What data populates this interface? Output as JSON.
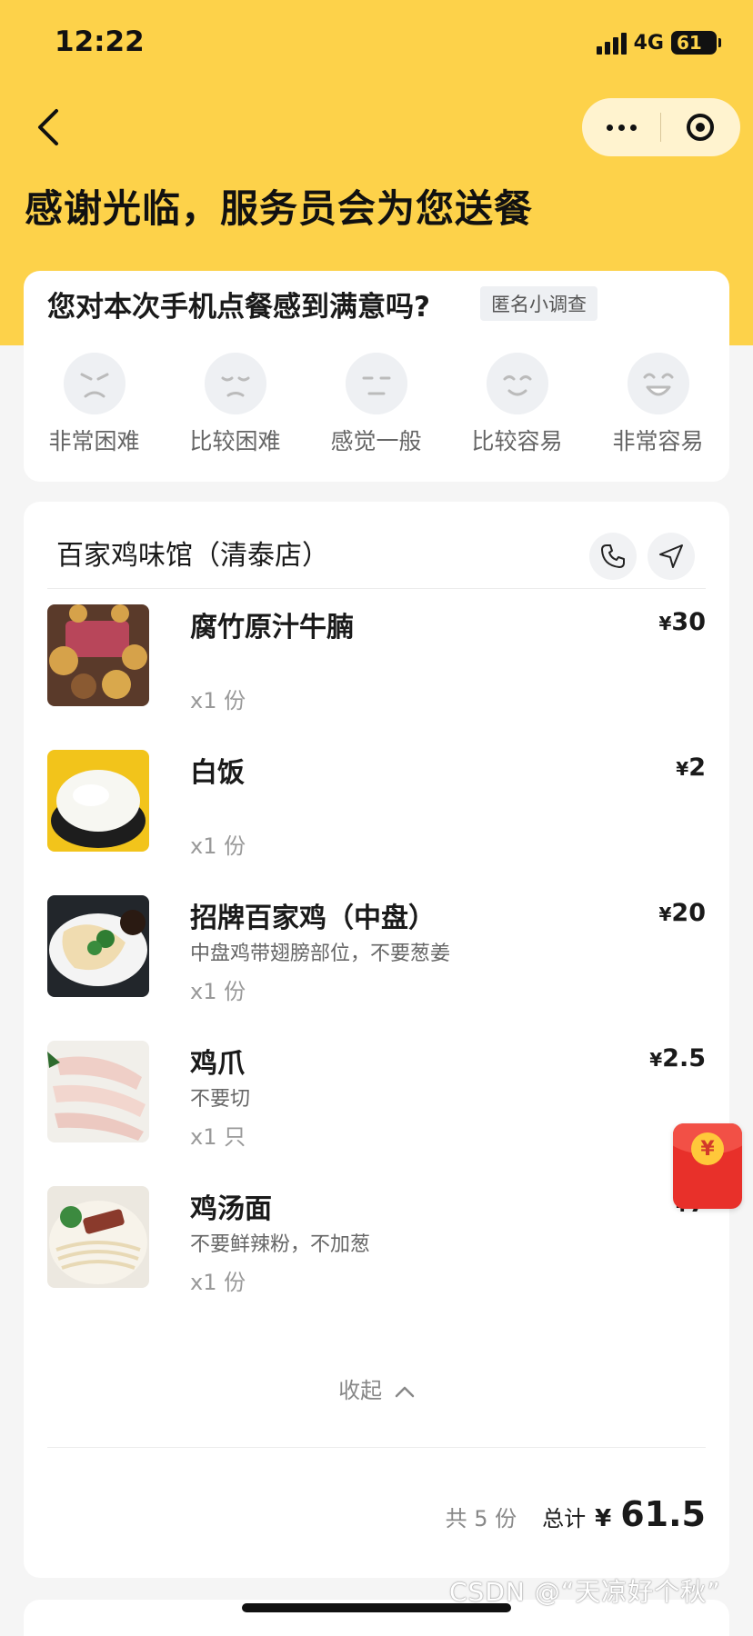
{
  "status_bar": {
    "time": "12:22",
    "network": "4G",
    "battery": "61"
  },
  "nav": {
    "back_icon": "chevron-left-icon",
    "more_icon": "more-dots-icon",
    "close_icon": "target-icon"
  },
  "header": {
    "title": "感谢光临，服务员会为您送餐"
  },
  "survey": {
    "question": "您对本次手机点餐感到满意吗?",
    "tag": "匿名小调查",
    "options": [
      {
        "label": "非常困难",
        "icon": "angry-face-icon"
      },
      {
        "label": "比较困难",
        "icon": "sad-face-icon"
      },
      {
        "label": "感觉一般",
        "icon": "neutral-face-icon"
      },
      {
        "label": "比较容易",
        "icon": "smile-face-icon"
      },
      {
        "label": "非常容易",
        "icon": "laugh-face-icon"
      }
    ]
  },
  "order": {
    "shop_name": "百家鸡味馆（清泰店）",
    "phone_icon": "phone-icon",
    "nav_icon": "navigation-arrow-icon",
    "items": [
      {
        "name": "腐竹原汁牛腩",
        "note": "",
        "qty": "x1 份",
        "price": "30",
        "image": "beef-brisket-photo"
      },
      {
        "name": "白饭",
        "note": "",
        "qty": "x1 份",
        "price": "2",
        "image": "rice-photo"
      },
      {
        "name": "招牌百家鸡（中盘）",
        "note": "中盘鸡带翅膀部位，不要葱姜",
        "qty": "x1 份",
        "price": "20",
        "image": "chicken-photo"
      },
      {
        "name": "鸡爪",
        "note": "不要切",
        "qty": "x1 只",
        "price": "2.5",
        "image": "chicken-feet-photo"
      },
      {
        "name": "鸡汤面",
        "note": "不要鲜辣粉，不加葱",
        "qty": "x1 份",
        "price": "7",
        "image": "noodle-soup-photo"
      }
    ],
    "collapse_label": "收起",
    "count_text": "共 5 份",
    "total_label": "总计",
    "currency": "¥",
    "total": "61.5"
  },
  "floating": {
    "icon": "red-packet-icon",
    "symbol": "¥"
  },
  "watermark": "CSDN @“天凉好个秋”",
  "colors": {
    "brand_yellow": "#fdd24a",
    "page_bg": "#f5f5f5",
    "card_bg": "#ffffff"
  }
}
